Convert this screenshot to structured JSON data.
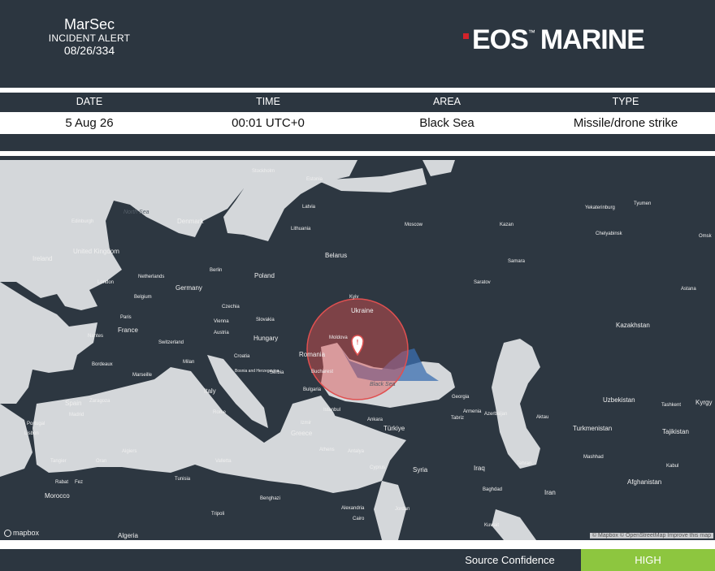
{
  "header": {
    "title": "MarSec",
    "subtitle": "INCIDENT ALERT",
    "reference": "08/26/334",
    "logo_text_1": "EOS",
    "logo_tm": "™",
    "logo_text_2": "MARINE"
  },
  "incident": {
    "columns": [
      "DATE",
      "TIME",
      "AREA",
      "TYPE"
    ],
    "values": [
      "5 Aug 26",
      "00:01 UTC+0",
      "Black Sea",
      "Missile/drone strike"
    ]
  },
  "map": {
    "attribution": "© Mapbox © OpenStreetMap Improve this map",
    "provider": "mapbox",
    "labels": [
      "North Sea",
      "Denmark",
      "Edinburgh",
      "United Kingdom",
      "Ireland",
      "London",
      "Netherlands",
      "Belgium",
      "Paris",
      "France",
      "Berlin",
      "Germany",
      "Czechia",
      "Austria",
      "Switzerland",
      "Poland",
      "Slovakia",
      "Hungary",
      "Croatia",
      "Bosnia and Herzegovina",
      "Serbia",
      "Romania",
      "Bucharest",
      "Bulgaria",
      "Moldova",
      "Ukraine",
      "Kyiv",
      "Belarus",
      "Lithuania",
      "Latvia",
      "Estonia",
      "Stockholm",
      "Moscow",
      "Kazan",
      "Samara",
      "Saratov",
      "Yekaterinburg",
      "Chelyabinsk",
      "Astana",
      "Kazakhstan",
      "Uzbekistan",
      "Turkmenistan",
      "Tajikistan",
      "Kyrgy",
      "Tashkent",
      "Afghanistan",
      "Iran",
      "Tehran",
      "Mashhad",
      "Kabul",
      "Georgia",
      "Armenia",
      "Azerbaijan",
      "Türkiye",
      "Ankara",
      "Istanbul",
      "Greece",
      "Athens",
      "Syria",
      "Jordan",
      "Iraq",
      "Baghdad",
      "Kuwait",
      "Cairo",
      "Alexandria",
      "Tunisia",
      "Tripoli",
      "Algeria",
      "Morocco",
      "Spain",
      "Madrid",
      "Lisbon",
      "Portugal",
      "Zaragoza",
      "Bordeaux",
      "Nantes",
      "Italy",
      "Rome",
      "Marseille",
      "Algiers",
      "Valletta",
      "Benghazi",
      "Tabriz",
      "Black Sea",
      "Vienna",
      "Tyumen",
      "Omsk",
      "Milan",
      "Rabat",
      "Fez",
      "Antalya",
      "Cyprus",
      "Izmir",
      "Aktau",
      "Oran",
      "Tangier"
    ],
    "incident_marker": "!"
  },
  "footer": {
    "confidence_label": "Source Confidence",
    "confidence_value": "HIGH"
  },
  "colors": {
    "background": "#2c3640",
    "sea": "#d4d7da",
    "land": "#2d3741",
    "impact_zone": "#e05050",
    "confidence": "#8dc63f",
    "logo_accent": "#d2232a"
  }
}
